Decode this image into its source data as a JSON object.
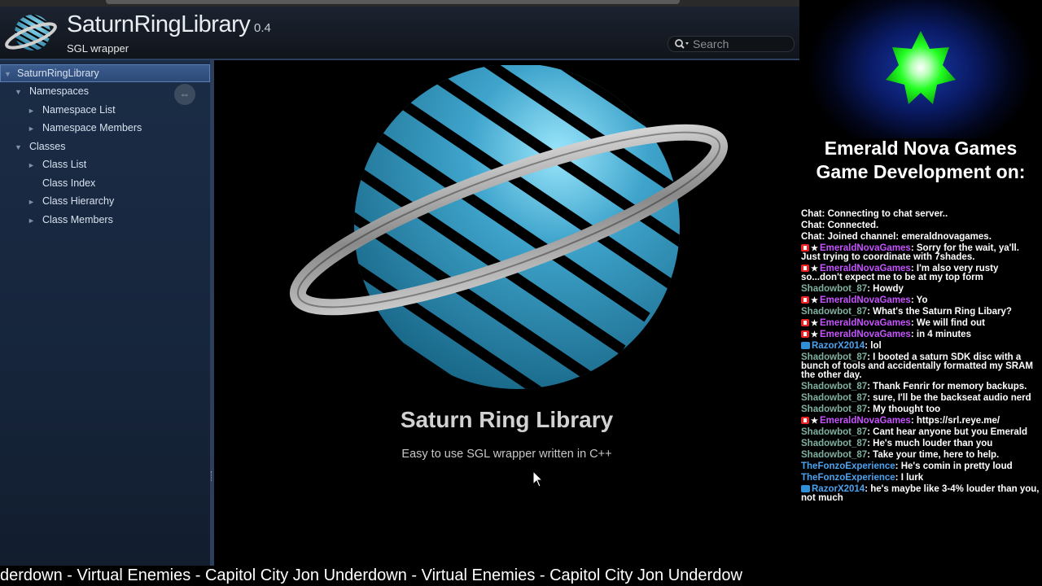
{
  "header": {
    "project_name": "SaturnRingLibrary",
    "version": "0.4",
    "brief": "SGL wrapper",
    "search_placeholder": "Search"
  },
  "sidebar": {
    "items": [
      {
        "label": "SaturnRingLibrary",
        "arrow": "▼"
      },
      {
        "label": "Namespaces",
        "arrow": "▼"
      },
      {
        "label": "Namespace List",
        "arrow": "►"
      },
      {
        "label": "Namespace Members",
        "arrow": "►"
      },
      {
        "label": "Classes",
        "arrow": "▼"
      },
      {
        "label": "Class List",
        "arrow": "►"
      },
      {
        "label": "Class Index",
        "arrow": ""
      },
      {
        "label": "Class Hierarchy",
        "arrow": "►"
      },
      {
        "label": "Class Members",
        "arrow": "►"
      }
    ],
    "sync_icon": "⇔"
  },
  "main": {
    "title": "Saturn Ring Library",
    "subtitle": "Easy to use SGL wrapper written in C++"
  },
  "ticker": {
    "text": "derdown - Virtual Enemies - Capitol City  Jon Underdown - Virtual Enemies - Capitol City  Jon Underdow"
  },
  "overlay": {
    "title_line1": "Emerald Nova Games",
    "title_line2": "Game Development on:",
    "star_color": "#22ff22"
  },
  "chat": [
    {
      "user": "",
      "text": "Chat: Connecting to chat server..",
      "color": "#ffffff",
      "badges": []
    },
    {
      "user": "",
      "text": "Chat: Connected.",
      "color": "#ffffff",
      "badges": []
    },
    {
      "user": "",
      "text": "Chat: Joined channel: emeraldnovagames.",
      "color": "#ffffff",
      "badges": []
    },
    {
      "user": "EmeraldNovaGames",
      "text": ": Sorry for the wait, ya'll. Just trying to coordinate with 7shades.",
      "color": "#c653ff",
      "badges": [
        "mod",
        "star"
      ]
    },
    {
      "user": "EmeraldNovaGames",
      "text": ": I'm also very rusty so...don't expect me to be at my top form",
      "color": "#c653ff",
      "badges": [
        "mod",
        "star"
      ]
    },
    {
      "user": "Shadowbot_87",
      "text": ": Howdy",
      "color": "#7fb0a0",
      "badges": []
    },
    {
      "user": "EmeraldNovaGames",
      "text": ": Yo",
      "color": "#c653ff",
      "badges": [
        "mod",
        "star"
      ]
    },
    {
      "user": "Shadowbot_87",
      "text": ": What's the Saturn Ring Libary?",
      "color": "#7fb0a0",
      "badges": []
    },
    {
      "user": "EmeraldNovaGames",
      "text": ": We will find out",
      "color": "#c653ff",
      "badges": [
        "mod",
        "star"
      ]
    },
    {
      "user": "EmeraldNovaGames",
      "text": ": in 4 minutes",
      "color": "#c653ff",
      "badges": [
        "mod",
        "star"
      ]
    },
    {
      "user": "RazorX2014",
      "text": ": lol",
      "color": "#4aa3f0",
      "badges": [
        "sub"
      ]
    },
    {
      "user": "Shadowbot_87",
      "text": ": I booted a saturn SDK disc with a bunch of tools and accidentally formatted my SRAM the other day.",
      "color": "#7fb0a0",
      "badges": []
    },
    {
      "user": "Shadowbot_87",
      "text": ": Thank Fenrir for memory backups.",
      "color": "#7fb0a0",
      "badges": []
    },
    {
      "user": "Shadowbot_87",
      "text": ": sure, I'll be the backseat audio nerd",
      "color": "#7fb0a0",
      "badges": []
    },
    {
      "user": "Shadowbot_87",
      "text": ": My thought too",
      "color": "#7fb0a0",
      "badges": []
    },
    {
      "user": "EmeraldNovaGames",
      "text": ": https://srl.reye.me/",
      "color": "#c653ff",
      "badges": [
        "mod",
        "star"
      ]
    },
    {
      "user": "Shadowbot_87",
      "text": ": Cant hear anyone but you Emerald",
      "color": "#7fb0a0",
      "badges": []
    },
    {
      "user": "Shadowbot_87",
      "text": ": He's much louder than you",
      "color": "#7fb0a0",
      "badges": []
    },
    {
      "user": "Shadowbot_87",
      "text": ": Take your time, here to help.",
      "color": "#7fb0a0",
      "badges": []
    },
    {
      "user": "TheFonzoExperience",
      "text": ": He's comin in pretty loud",
      "color": "#4aa3f0",
      "badges": []
    },
    {
      "user": "TheFonzoExperience",
      "text": ": I lurk",
      "color": "#4aa3f0",
      "badges": []
    },
    {
      "user": "RazorX2014",
      "text": ": he's maybe like 3-4% louder than you, not much",
      "color": "#4aa3f0",
      "badges": [
        "sub"
      ]
    }
  ]
}
